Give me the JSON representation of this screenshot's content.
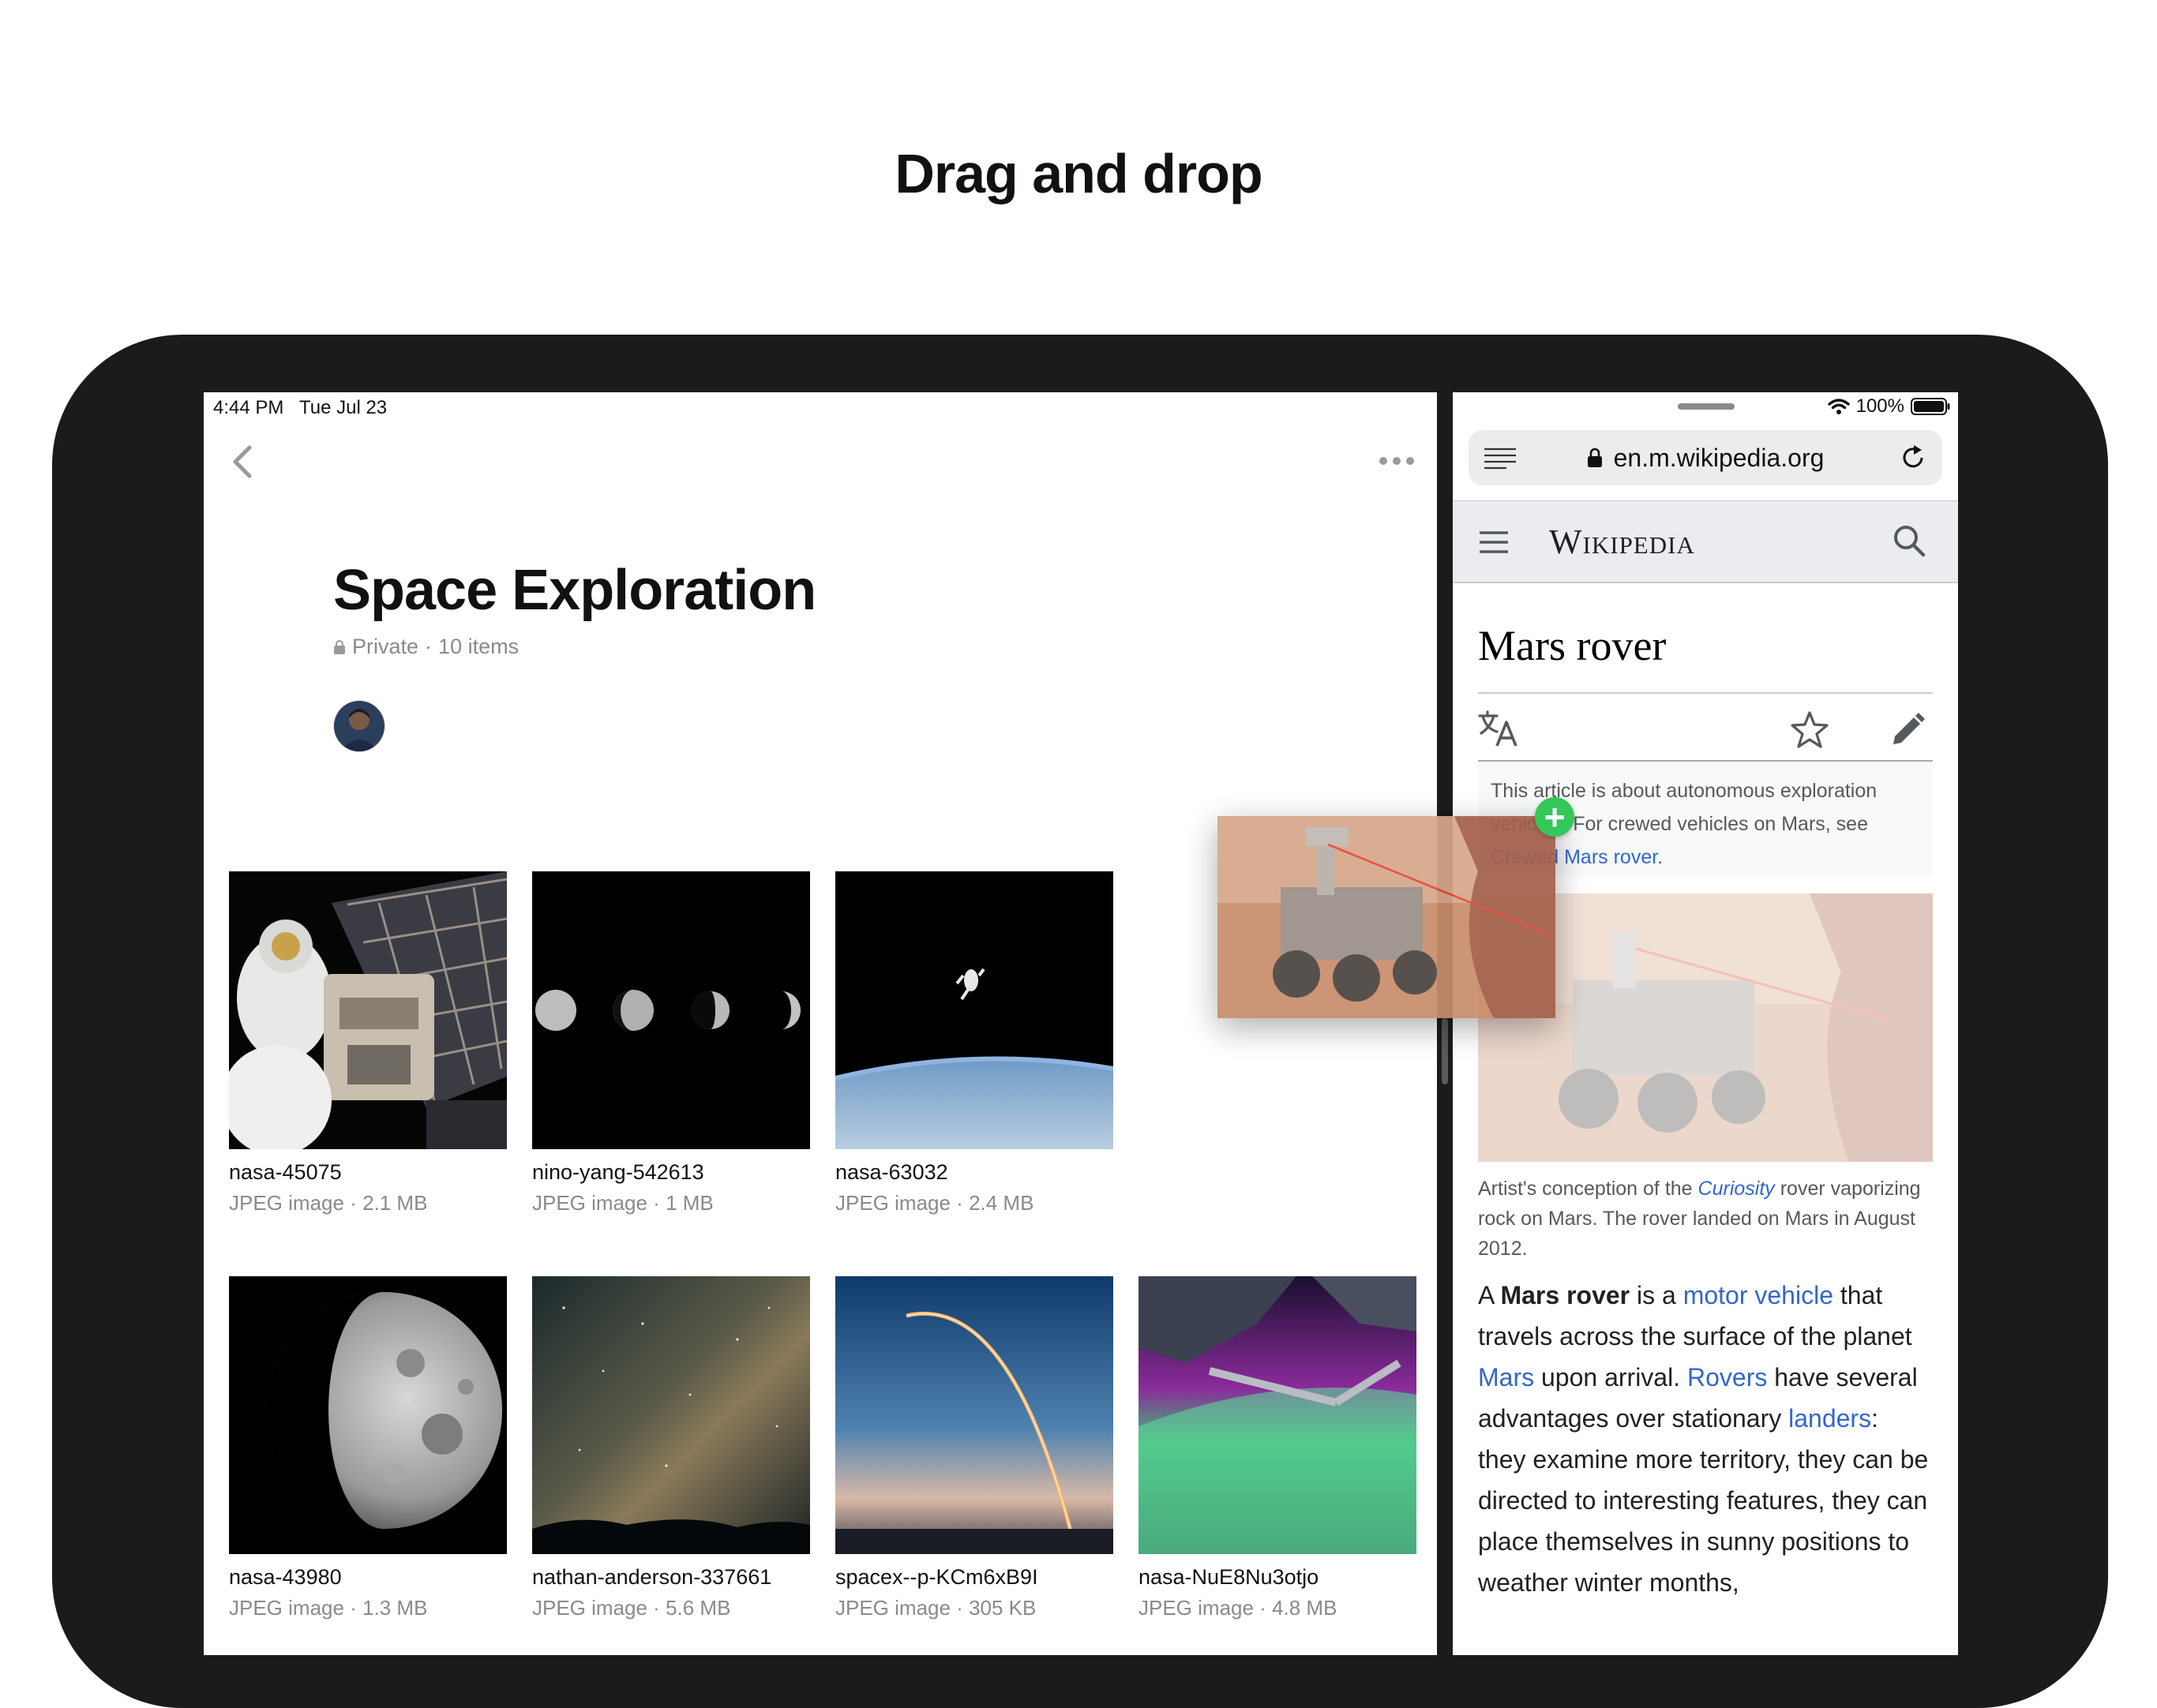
{
  "headline": "Drag and drop",
  "left_app": {
    "status": {
      "time": "4:44 PM",
      "date": "Tue Jul 23"
    },
    "collection": {
      "title": "Space Exploration",
      "privacy": "Private",
      "count": "10 items",
      "separator": "·"
    },
    "items": [
      {
        "name": "nasa-45075",
        "type": "JPEG image",
        "size": "2.1 MB",
        "image": "astronaut-spacewalk"
      },
      {
        "name": "nino-yang-542613",
        "type": "JPEG image",
        "size": "1 MB",
        "image": "moon-phases"
      },
      {
        "name": "nasa-63032",
        "type": "JPEG image",
        "size": "2.4 MB",
        "image": "astronaut-over-earth"
      },
      {
        "name": "nasa-43980",
        "type": "JPEG image",
        "size": "1.3 MB",
        "image": "half-moon"
      },
      {
        "name": "nathan-anderson-337661",
        "type": "JPEG image",
        "size": "5.6 MB",
        "image": "milky-way"
      },
      {
        "name": "spacex--p-KCm6xB9I",
        "type": "JPEG image",
        "size": "305 KB",
        "image": "rocket-launch-arc"
      },
      {
        "name": "nasa-NuE8Nu3otjo",
        "type": "JPEG image",
        "size": "4.8 MB",
        "image": "aurora-from-station"
      }
    ]
  },
  "right_app": {
    "status": {
      "battery": "100%"
    },
    "url": "en.m.wikipedia.org",
    "site_logo": "Wikipedia",
    "article": {
      "title": "Mars rover",
      "hatnote": {
        "t1": "This article is about autonomous exploration vehicles. For crewed vehicles on Mars, see ",
        "link": "Crewed Mars rover",
        "t2": "."
      },
      "caption": {
        "t1": "Artist's conception of the ",
        "italic_link": "Curiosity",
        "t2": " rover vaporizing rock on Mars. The rover landed on Mars in August 2012."
      },
      "body": {
        "t1": "A ",
        "bold": "Mars rover",
        "t2": " is a ",
        "l1": "motor vehicle",
        "t3": " that travels across the surface of the planet ",
        "l2": "Mars",
        "t4": " upon arrival. ",
        "l3": "Rovers",
        "t5": " have several advantages over stationary ",
        "l4": "landers",
        "t6": ": they examine more territory, they can be directed to interesting features, they can place themselves in sunny positions to weather winter months,"
      }
    }
  },
  "drag": {
    "badge": "+",
    "image": "mars-rover-photo"
  },
  "colors": {
    "link": "#3366cc",
    "badge": "#34c759",
    "frame": "#1a1c1c"
  }
}
